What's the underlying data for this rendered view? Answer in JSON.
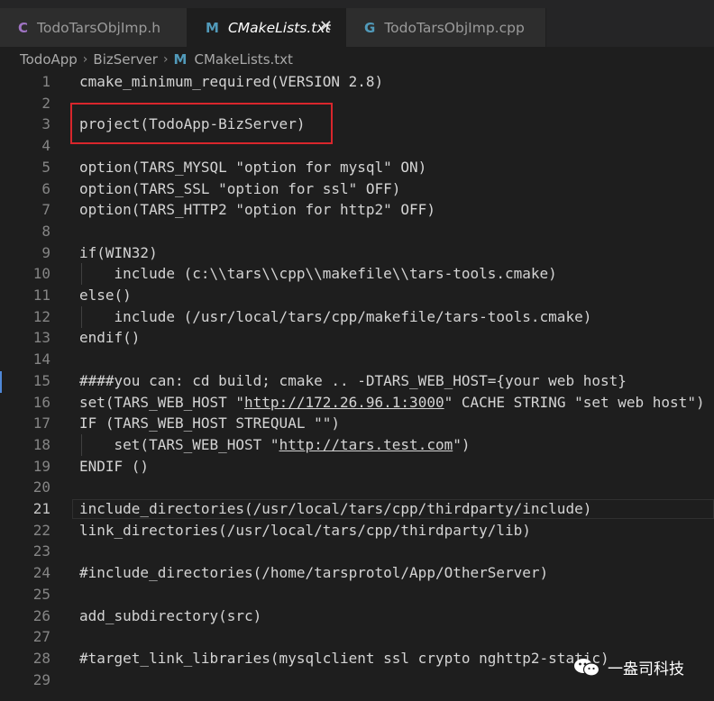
{
  "tabs": [
    {
      "icon": "C",
      "label": "TodoTarsObjImp.h",
      "active": false
    },
    {
      "icon": "M",
      "label": "CMakeLists.txt",
      "active": true,
      "close": "✕"
    },
    {
      "icon": "G",
      "label": "TodoTarsObjImp.cpp",
      "active": false
    }
  ],
  "breadcrumb": {
    "items": [
      "TodoApp",
      "BizServer"
    ],
    "separator": "›",
    "file": "CMakeLists.txt",
    "file_icon": "M"
  },
  "editor": {
    "current_line": 21,
    "lines": [
      {
        "n": "1",
        "t": "cmake_minimum_required(VERSION 2.8)"
      },
      {
        "n": "2",
        "t": ""
      },
      {
        "n": "3",
        "t": "project(TodoApp-BizServer)"
      },
      {
        "n": "4",
        "t": ""
      },
      {
        "n": "5",
        "t": "option(TARS_MYSQL \"option for mysql\" ON)"
      },
      {
        "n": "6",
        "t": "option(TARS_SSL \"option for ssl\" OFF)"
      },
      {
        "n": "7",
        "t": "option(TARS_HTTP2 \"option for http2\" OFF)"
      },
      {
        "n": "8",
        "t": ""
      },
      {
        "n": "9",
        "t": "if(WIN32)"
      },
      {
        "n": "10",
        "t": "    include (c:\\\\tars\\\\cpp\\\\makefile\\\\tars-tools.cmake)"
      },
      {
        "n": "11",
        "t": "else()"
      },
      {
        "n": "12",
        "t": "    include (/usr/local/tars/cpp/makefile/tars-tools.cmake)"
      },
      {
        "n": "13",
        "t": "endif()"
      },
      {
        "n": "14",
        "t": ""
      },
      {
        "n": "15",
        "t": "####you can: cd build; cmake .. -DTARS_WEB_HOST={your web host}"
      },
      {
        "n": "16",
        "pre": "set(TARS_WEB_HOST \"",
        "link": "http://172.26.96.1:3000",
        "post": "\" CACHE STRING \"set web host\")"
      },
      {
        "n": "17",
        "t": "IF (TARS_WEB_HOST STREQUAL \"\")"
      },
      {
        "n": "18",
        "pre": "    set(TARS_WEB_HOST \"",
        "link": "http://tars.test.com",
        "post": "\")"
      },
      {
        "n": "19",
        "t": "ENDIF ()"
      },
      {
        "n": "20",
        "t": ""
      },
      {
        "n": "21",
        "t": "include_directories(/usr/local/tars/cpp/thirdparty/include)"
      },
      {
        "n": "22",
        "t": "link_directories(/usr/local/tars/cpp/thirdparty/lib)"
      },
      {
        "n": "23",
        "t": ""
      },
      {
        "n": "24",
        "t": "#include_directories(/home/tarsprotol/App/OtherServer)"
      },
      {
        "n": "25",
        "t": ""
      },
      {
        "n": "26",
        "t": "add_subdirectory(src)"
      },
      {
        "n": "27",
        "t": ""
      },
      {
        "n": "28",
        "t": "#target_link_libraries(mysqlclient ssl crypto nghttp2-static)"
      },
      {
        "n": "29",
        "t": ""
      }
    ]
  },
  "watermark": {
    "text": "一盎司科技",
    "icon": "wechat-icon"
  }
}
